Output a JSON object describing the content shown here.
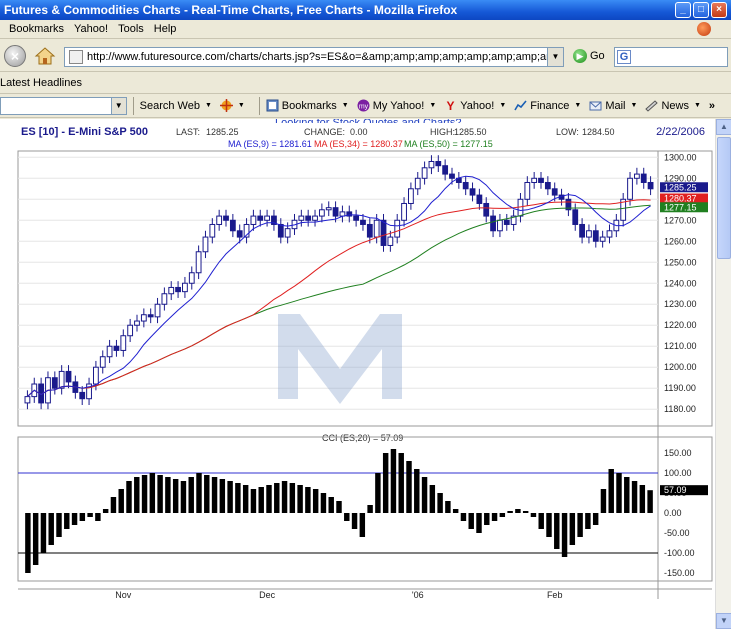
{
  "window": {
    "title": "Futures & Commodities Charts - Real-Time Charts, Free Charts - Mozilla Firefox",
    "min": "_",
    "max": "□",
    "close": "×"
  },
  "menu": [
    {
      "label": "Bookmarks"
    },
    {
      "label": "Yahoo!"
    },
    {
      "label": "Tools"
    },
    {
      "label": "Help"
    }
  ],
  "nav": {
    "url": "http://www.futuresource.com/charts/charts.jsp?s=ES&o=&amp;amp;amp;amp;amp;amp;amp;amp;a=D&z",
    "go_label": "Go"
  },
  "bookmarks_bar": {
    "latest_headlines": "Latest Headlines"
  },
  "yahoo_bar": {
    "search_web": "Search Web",
    "bookmarks": "Bookmarks",
    "my_yahoo": "My Yahoo!",
    "yahoo": "Yahoo!",
    "finance": "Finance",
    "mail": "Mail",
    "news": "News",
    "more": "»"
  },
  "page": {
    "banner_link": "Looking for Stock Quotes and Charts?"
  },
  "colors": {
    "candle": "#1a1a8c",
    "ma9": "#2020d0",
    "ma34": "#e02020",
    "ma50": "#208020",
    "cci": "#000000",
    "cci_line": "#3030d0"
  },
  "chart_data": [
    {
      "type": "candlestick",
      "title": "ES [10] - E-Mini S&P 500",
      "date": "2/22/2006",
      "stats": {
        "last_label": "LAST:",
        "last": "1285.25",
        "change_label": "CHANGE:",
        "change": "0.00",
        "high_label": "HIGH:",
        "high": "1285.50",
        "low_label": "LOW:",
        "low": "1284.50"
      },
      "moving_averages": [
        {
          "label": "MA (ES,9) = 1281.61",
          "value": 1281.61,
          "color": "#2020d0"
        },
        {
          "label": "MA (ES,34) = 1280.37",
          "value": 1280.37,
          "color": "#e02020"
        },
        {
          "label": "MA (ES,50) = 1277.15",
          "value": 1277.15,
          "color": "#208020"
        }
      ],
      "price_tags": [
        "1285.25",
        "1280.37",
        "1277.15"
      ],
      "y_ticks": [
        "1300.00",
        "1290.00",
        "1280.00",
        "1270.00",
        "1260.00",
        "1250.00",
        "1240.00",
        "1230.00",
        "1220.00",
        "1210.00",
        "1200.00",
        "1190.00",
        "1180.00"
      ],
      "ylim": [
        1172,
        1303
      ],
      "x_labels": [
        "Nov",
        "Dec",
        "'06",
        "Feb"
      ],
      "x_label_positions": [
        14,
        35,
        57,
        77
      ],
      "closes": [
        1186,
        1192,
        1183,
        1195,
        1190,
        1198,
        1193,
        1188,
        1185,
        1192,
        1200,
        1205,
        1210,
        1208,
        1215,
        1220,
        1222,
        1225,
        1224,
        1230,
        1235,
        1238,
        1236,
        1240,
        1245,
        1255,
        1262,
        1268,
        1272,
        1270,
        1265,
        1262,
        1268,
        1272,
        1270,
        1272,
        1268,
        1262,
        1266,
        1270,
        1272,
        1270,
        1272,
        1275,
        1276,
        1272,
        1274,
        1272,
        1270,
        1268,
        1262,
        1270,
        1258,
        1262,
        1270,
        1278,
        1285,
        1290,
        1295,
        1298,
        1296,
        1292,
        1290,
        1288,
        1285,
        1282,
        1278,
        1272,
        1265,
        1270,
        1268,
        1272,
        1280,
        1288,
        1290,
        1288,
        1285,
        1282,
        1280,
        1275,
        1268,
        1262,
        1265,
        1260,
        1262,
        1265,
        1270,
        1280,
        1290,
        1292,
        1288,
        1285
      ]
    },
    {
      "type": "line",
      "title": "CCI (ES,20) = 57.09",
      "indicator_tag": "57.09",
      "y_ticks": [
        "150.00",
        "100.00",
        "50.00",
        "0.00",
        "-50.00",
        "-100.00",
        "-150.00"
      ],
      "ylim": [
        -170,
        170
      ],
      "reference_lines": [
        100,
        -100
      ],
      "values": [
        -150,
        -130,
        -100,
        -80,
        -60,
        -40,
        -30,
        -20,
        -10,
        -20,
        10,
        40,
        60,
        80,
        90,
        95,
        100,
        95,
        90,
        85,
        80,
        90,
        100,
        95,
        90,
        85,
        80,
        75,
        70,
        60,
        65,
        70,
        75,
        80,
        75,
        70,
        65,
        60,
        50,
        40,
        30,
        -20,
        -40,
        -60,
        20,
        100,
        150,
        160,
        150,
        130,
        110,
        90,
        70,
        50,
        30,
        10,
        -20,
        -40,
        -50,
        -30,
        -20,
        -10,
        5,
        10,
        5,
        -10,
        -40,
        -60,
        -90,
        -110,
        -80,
        -60,
        -40,
        -30,
        60,
        110,
        100,
        90,
        80,
        70,
        57
      ]
    }
  ]
}
